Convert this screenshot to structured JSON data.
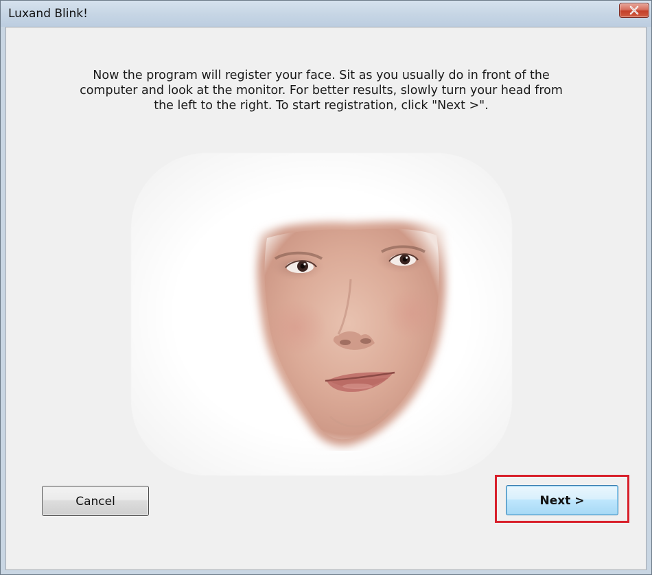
{
  "window": {
    "title": "Luxand Blink!"
  },
  "content": {
    "instructions": "Now the program will register your face. Sit as you usually do in front of the computer and look at the monitor. For better results, slowly turn your head from the left to the right. To start registration, click \"Next  >\"."
  },
  "buttons": {
    "cancel_label": "Cancel",
    "next_label": "Next >"
  },
  "icons": {
    "close": "close-icon"
  },
  "colors": {
    "highlight": "#d8202b",
    "close_button": "#c4412b",
    "next_button": "#bee6fd"
  }
}
